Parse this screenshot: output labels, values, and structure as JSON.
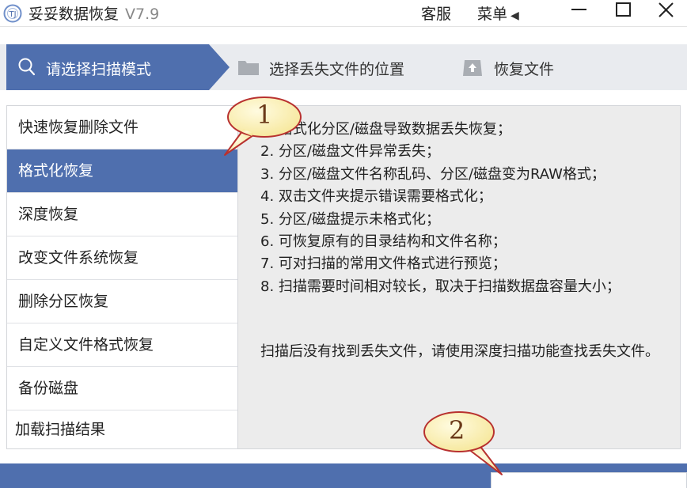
{
  "titlebar": {
    "title": "妥妥数据恢复",
    "version": "V7.9",
    "service_label": "客服",
    "menu_label": "菜单",
    "menu_caret": "◀",
    "logo_text": "TJ"
  },
  "steps": [
    {
      "label": "请选择扫描模式",
      "icon": "search-icon",
      "state": "active"
    },
    {
      "label": "选择丢失文件的位置",
      "icon": "folder-icon",
      "state": "pending"
    },
    {
      "label": "恢复文件",
      "icon": "upload-icon",
      "state": "pending"
    }
  ],
  "menu": {
    "items": [
      {
        "label": "快速恢复删除文件"
      },
      {
        "label": "格式化恢复",
        "active": true
      },
      {
        "label": "深度恢复"
      },
      {
        "label": "改变文件系统恢复"
      },
      {
        "label": "删除分区恢复"
      },
      {
        "label": "自定义文件格式恢复"
      },
      {
        "label": "备份磁盘"
      },
      {
        "label": "加载扫描结果"
      }
    ]
  },
  "description": {
    "lines": [
      "1. 格式化分区/磁盘导致数据丢失恢复；",
      "2. 分区/磁盘文件异常丢失；",
      "3. 分区/磁盘文件名称乱码、分区/磁盘变为RAW格式；",
      "4. 双击文件夹提示错误需要格式化；",
      "5. 分区/磁盘提示未格式化；",
      "6. 可恢复原有的目录结构和文件名称；",
      "7. 可对扫描的常用文件格式进行预览；",
      "8. 扫描需要时间相对较长，取决于扫描数据盘容量大小；"
    ],
    "note": "扫描后没有找到丢失文件，请使用深度扫描功能查找丢失文件。"
  },
  "callouts": [
    {
      "number": "1"
    },
    {
      "number": "2"
    }
  ],
  "colors": {
    "accent": "#4f6fae",
    "panel_bg": "#ececec",
    "stepbar_bg": "#e9ebef",
    "callout_fill": "#fdf5c6",
    "callout_stroke": "#b8312f"
  }
}
